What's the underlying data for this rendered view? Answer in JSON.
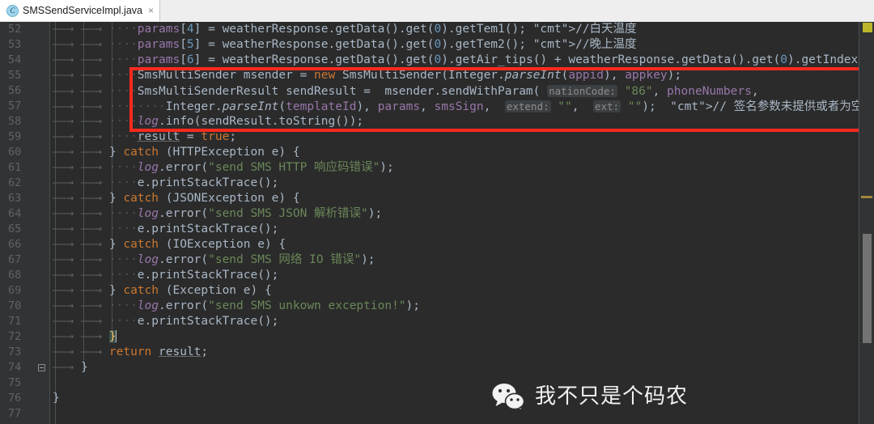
{
  "window": {
    "tab": {
      "icon": "java-class-icon",
      "label": "SMSSendServiceImpl.java",
      "close": "×"
    }
  },
  "editor": {
    "theme": "darcula",
    "colors": {
      "background": "#2b2b2b",
      "gutter": "#313335",
      "default_text": "#a9b7c6",
      "keyword": "#cc7832",
      "string": "#6a8759",
      "number": "#6897bb",
      "comment": "#808080",
      "field": "#9876aa",
      "line_number": "#606366",
      "annotation_box": "#fc2a1f",
      "brace_match": "#3b514d",
      "warning_marker": "#bbb529"
    },
    "first_line": 52,
    "last_line": 77,
    "lines": [
      {
        "n": 52,
        "text": "            params[4] = weatherResponse.getData().get(0).getTem1(); //白天温度"
      },
      {
        "n": 53,
        "text": "            params[5] = weatherResponse.getData().get(0).getTem2(); //晚上温度"
      },
      {
        "n": 54,
        "text": "            params[6] = weatherResponse.getData().get(0).getAir_tips() + weatherResponse.getData().get(0).getIndex()"
      },
      {
        "n": 55,
        "text": "            SmsMultiSender msender = new SmsMultiSender(Integer.parseInt(appid), appkey);"
      },
      {
        "n": 56,
        "text": "            SmsMultiSenderResult sendResult =  msender.sendWithParam( nationCode: \"86\", phoneNumbers,"
      },
      {
        "n": 57,
        "text": "                Integer.parseInt(templateId), params, smsSign,  extend: \"\",  ext: \"\");  // 签名参数未提供或者为空时，会使用默认"
      },
      {
        "n": 58,
        "text": "            log.info(sendResult.toString());"
      },
      {
        "n": 59,
        "text": "            result = true;"
      },
      {
        "n": 60,
        "text": "        } catch (HTTPException e) {"
      },
      {
        "n": 61,
        "text": "            log.error(\"send SMS HTTP 响应码错误\");"
      },
      {
        "n": 62,
        "text": "            e.printStackTrace();"
      },
      {
        "n": 63,
        "text": "        } catch (JSONException e) {"
      },
      {
        "n": 64,
        "text": "            log.error(\"send SMS JSON 解析错误\");"
      },
      {
        "n": 65,
        "text": "            e.printStackTrace();"
      },
      {
        "n": 66,
        "text": "        } catch (IOException e) {"
      },
      {
        "n": 67,
        "text": "            log.error(\"send SMS 网络 IO 错误\");"
      },
      {
        "n": 68,
        "text": "            e.printStackTrace();"
      },
      {
        "n": 69,
        "text": "        } catch (Exception e) {"
      },
      {
        "n": 70,
        "text": "            log.error(\"send SMS unkown exception!\");"
      },
      {
        "n": 71,
        "text": "            e.printStackTrace();"
      },
      {
        "n": 72,
        "text": "        }"
      },
      {
        "n": 73,
        "text": "        return result;"
      },
      {
        "n": 74,
        "text": "    }"
      },
      {
        "n": 75,
        "text": ""
      },
      {
        "n": 76,
        "text": "}"
      },
      {
        "n": 77,
        "text": ""
      }
    ],
    "parameter_hints": [
      "nationCode:",
      "extend:",
      "ext:"
    ],
    "annotation_box": {
      "name": "red-highlight-box",
      "covers_lines": "55-58"
    },
    "caret_line": 72,
    "fold_marker_line": 74
  },
  "scrollbar": {
    "warning_marker": "warning",
    "line_marker": "modified-line",
    "arrow": "scroll-down-arrow"
  },
  "watermark": {
    "icon": "wechat-icon",
    "text": "我不只是个码农"
  },
  "line_numbers": [
    52,
    53,
    54,
    55,
    56,
    57,
    58,
    59,
    60,
    61,
    62,
    63,
    64,
    65,
    66,
    67,
    68,
    69,
    70,
    71,
    72,
    73,
    74,
    75,
    76,
    77
  ]
}
